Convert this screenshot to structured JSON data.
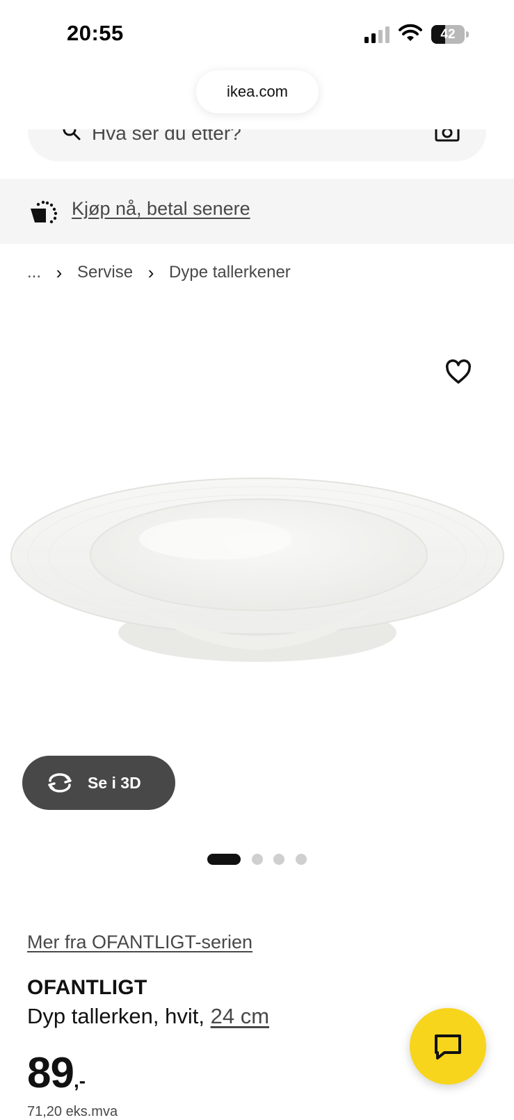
{
  "status_bar": {
    "time": "20:55",
    "battery_percent": "42",
    "battery_level": 0.42
  },
  "browser": {
    "url": "ikea.com"
  },
  "search": {
    "placeholder": "Hva ser du etter?"
  },
  "promo": {
    "text": "Kjøp nå, betal senere"
  },
  "breadcrumb": {
    "ellipsis": "...",
    "items": [
      "Servise",
      "Dype tallerkener"
    ]
  },
  "gallery": {
    "view3d_label": "Se i 3D",
    "dots_total": 4,
    "active_index": 0
  },
  "product": {
    "series_link": "Mer fra OFANTLIGT-serien",
    "name": "OFANTLIGT",
    "description": "Dyp tallerken, hvit, ",
    "size": "24 cm",
    "price_main": "89",
    "price_suffix": ",-",
    "unit_price": "71,20 eks.mva"
  },
  "colors": {
    "brand_yellow": "#f7d51c",
    "button_dark": "#484848",
    "banner_bg": "#f5f5f5"
  },
  "icons": {
    "search": "search-icon",
    "camera": "camera-icon",
    "promo": "basket-icon",
    "favorite": "heart-icon",
    "rotate": "rotate-3d-icon",
    "chat": "chat-icon"
  }
}
